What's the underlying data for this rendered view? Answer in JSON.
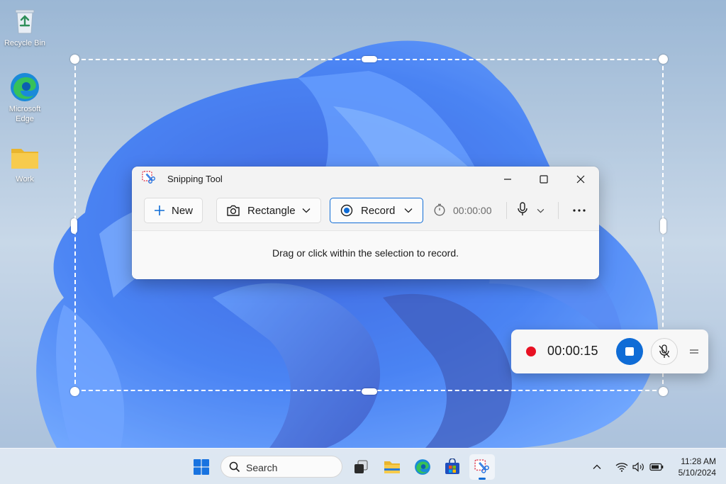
{
  "desktop": {
    "icons": [
      {
        "label": "Recycle Bin",
        "icon": "recycle-bin-icon"
      },
      {
        "label": "Microsoft Edge",
        "icon": "edge-icon"
      },
      {
        "label": "Work",
        "icon": "folder-icon"
      }
    ]
  },
  "snipping_tool": {
    "title": "Snipping Tool",
    "toolbar": {
      "new_label": "New",
      "mode_label": "Rectangle",
      "capture_label": "Record",
      "timer_value": "00:00:00"
    },
    "hint": "Drag or click within the selection to record."
  },
  "recording_bar": {
    "elapsed": "00:00:15"
  },
  "taskbar": {
    "search_label": "Search",
    "time": "11:28 AM",
    "date": "5/10/2024"
  },
  "colors": {
    "accent": "#0f6cd6",
    "record_red": "#e81123"
  }
}
